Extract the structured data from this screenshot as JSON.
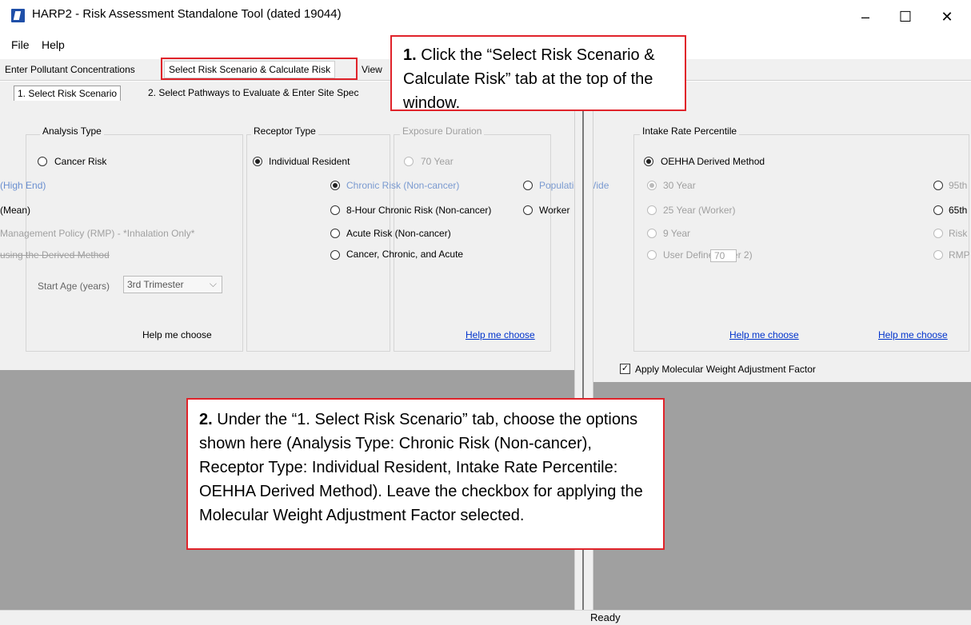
{
  "window": {
    "title": "HARP2 - Risk Assessment Standalone Tool (dated 19044)",
    "minimize": "–",
    "maximize": "☐",
    "close": "✕"
  },
  "menu": {
    "file": "File",
    "help": "Help"
  },
  "tabs": [
    "Enter Pollutant Concentrations",
    "Select Risk Scenario & Calculate Risk",
    "View"
  ],
  "subtabs": [
    "1. Select Risk Scenario",
    "2. Select Pathways to Evaluate & Enter Site Spec"
  ],
  "analysis_type": {
    "legend": "Analysis Type",
    "options": [
      "Cancer Risk",
      "Chronic Risk (Non-cancer)",
      "8-Hour Chronic Risk (Non-cancer)",
      "Acute Risk (Non-cancer)",
      "Cancer, Chronic, and Acute"
    ],
    "selected": "Chronic Risk (Non-cancer)"
  },
  "receptor_type": {
    "legend": "Receptor Type",
    "options": [
      "Individual Resident",
      "Population Wide",
      "Worker"
    ],
    "selected": "Individual Resident"
  },
  "exposure_duration": {
    "legend": "Exposure Duration",
    "options": [
      "70 Year",
      "30 Year",
      "25 Year (Worker)",
      "9 Year",
      "User Defined (Tier 2)"
    ],
    "selected": "30 Year",
    "user_value": "70"
  },
  "intake_rate": {
    "legend": "Intake Rate Percentile",
    "options": [
      "OEHHA Derived Method",
      "95th",
      "65th",
      "Risk",
      "RMP"
    ],
    "selected": "OEHHA Derived Method"
  },
  "overlap_fragments": {
    "high_end": "(High End)",
    "mean": "(Mean)",
    "rmp": "Management Policy (RMP) - *Inhalation Only*",
    "derived": "using the Derived Method"
  },
  "start_age": {
    "label": "Start Age (years)",
    "value": "3rd Trimester"
  },
  "help_links": {
    "plain": "Help me choose",
    "link1": "Help me choose",
    "link2": "Help me choose",
    "link3": "Help me choose"
  },
  "mwaf": {
    "label": "Apply Molecular Weight Adjustment Factor",
    "checked": true
  },
  "status": {
    "text": "Ready"
  },
  "callout1": {
    "num": "1.",
    "text": "Click the “Select Risk Scenario & Calculate Risk” tab at the top of the window."
  },
  "callout2": {
    "num": "2.",
    "text": "Under the “1. Select Risk Scenario” tab, choose the options shown here (Analysis Type: Chronic Risk (Non-cancer), Receptor Type: Individual Resident, Intake Rate Percentile: OEHHA Derived Method).  Leave the checkbox for applying the Molecular Weight Adjustment Factor selected."
  },
  "colors": {
    "accent_red": "#e0232a",
    "link_blue": "#0033cc",
    "panel_gray": "#a0a0a0"
  }
}
